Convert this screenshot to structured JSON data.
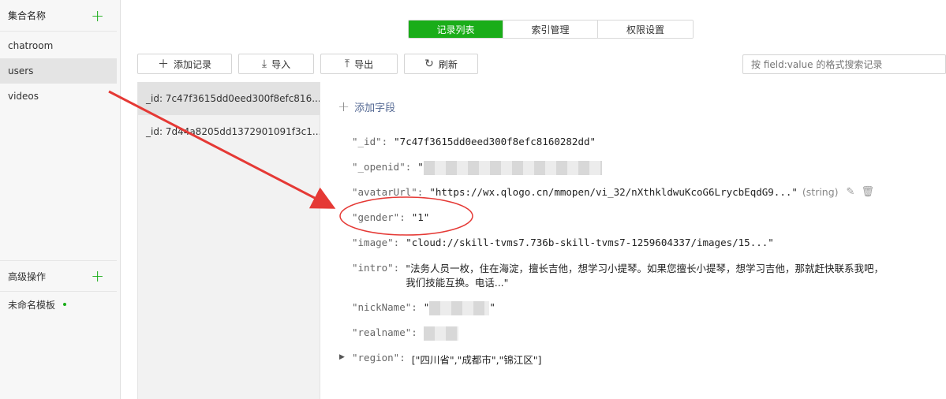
{
  "sidebar": {
    "header": "集合名称",
    "collections": [
      "chatroom",
      "users",
      "videos"
    ],
    "advanced_header": "高级操作",
    "template": "未命名模板"
  },
  "tabs": [
    "记录列表",
    "索引管理",
    "权限设置"
  ],
  "toolbar": {
    "add_record": "添加记录",
    "import": "导入",
    "export": "导出",
    "refresh": "刷新"
  },
  "search": {
    "placeholder": "按 field:value 的格式搜索记录"
  },
  "records": [
    "_id: 7c47f3615dd0eed300f8efc816...",
    "_id: 7d44a8205dd1372901091f3c1..."
  ],
  "detail": {
    "add_field": "添加字段",
    "fields": {
      "id": {
        "key": "\"_id\":",
        "value": "\"7c47f3615dd0eed300f8efc8160282dd\""
      },
      "openid": {
        "key": "\"_openid\":",
        "value": "\""
      },
      "avatar": {
        "key": "\"avatarUrl\":",
        "value": "\"https://wx.qlogo.cn/mmopen/vi_32/nXthkldwuKcoG6LrycbEqdG9...\"",
        "type": "(string)"
      },
      "gender": {
        "key": "\"gender\":",
        "value": "\"1\""
      },
      "image": {
        "key": "\"image\":",
        "value": "\"cloud://skill-tvms7.736b-skill-tvms7-1259604337/images/15...\""
      },
      "intro": {
        "key": "\"intro\":",
        "line1": "\"法务人员一枚，住在海淀，擅长吉他，想学习小提琴。如果您擅长小提琴，想学习吉他，那就赶快联系我吧，",
        "line2": "我们技能互换。电话...\""
      },
      "nickname": {
        "key": "\"nickName\":",
        "open": "\"",
        "close": "\""
      },
      "realname": {
        "key": "\"realname\":"
      },
      "region": {
        "key": "\"region\":",
        "value": "[\"四川省\",\"成都市\",\"锦江区\"]"
      }
    }
  },
  "colors": {
    "accent": "#1aad19",
    "link": "#576b95",
    "annotation": "#e53935"
  }
}
